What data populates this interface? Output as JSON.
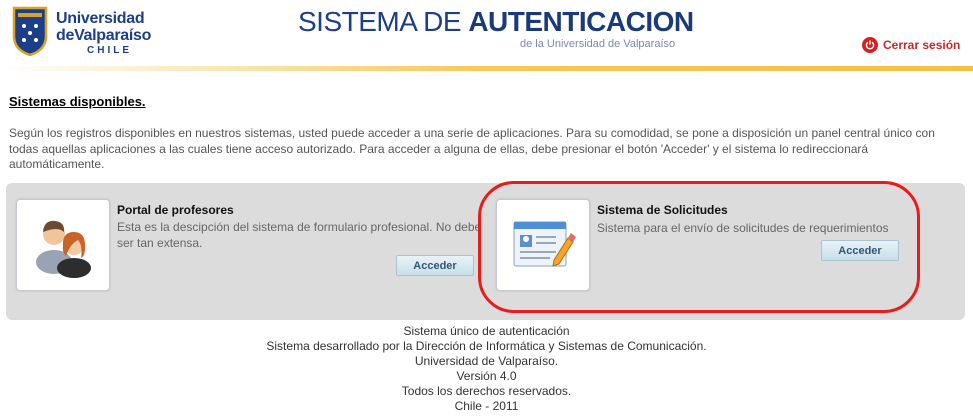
{
  "header": {
    "logo_line1": "Universidad",
    "logo_line2": "deValparaíso",
    "logo_country": "CHILE",
    "title_regular": "SISTEMA DE ",
    "title_bold": "AUTENTICACION",
    "subtitle": "de la Universidad de Valparaíso",
    "logout_label": "Cerrar sesión",
    "accent_color": "#f2c04a",
    "brand_color": "#1d3f8a"
  },
  "main": {
    "section_title": "Sistemas disponibles.",
    "intro_text": "Según los registros disponibles en nuestros sistemas, usted puede acceder a una serie de aplicaciones. Para su comodidad, se pone a disposición un panel central único con todas aquellas aplicaciones a las cuales tiene acceso autorizado. Para acceder a alguna de ellas, debe presionar el botón 'Acceder' y el sistema lo redireccionará automáticamente.",
    "apps": [
      {
        "icon": "users-icon",
        "title": "Portal de profesores",
        "description": "Esta es la descipción del sistema de formulario profesional. No debe ser tan extensa.",
        "button_label": "Acceder"
      },
      {
        "icon": "form-edit-icon",
        "title": "Sistema de Solicitudes",
        "description": "Sistema para el envío de solicitudes de requerimientos",
        "button_label": "Acceder"
      }
    ]
  },
  "footer": {
    "lines": [
      "Sistema único de autenticación",
      "Sistema desarrollado por la Dirección de Informática y Sistemas de Comunicación.",
      "Universidad de Valparaíso.",
      "Versión 4.0",
      "Todos los derechos reservados.",
      "Chile - 2011"
    ]
  }
}
